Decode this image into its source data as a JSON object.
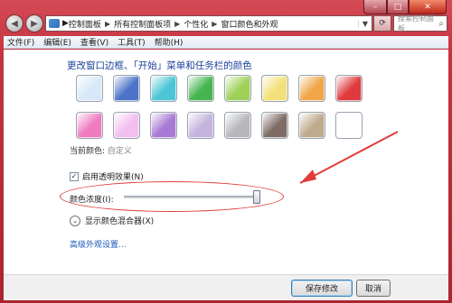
{
  "window": {
    "min_glyph": "–",
    "max_glyph": "□",
    "close_glyph": "✕"
  },
  "nav": {
    "back_glyph": "◀",
    "forward_glyph": "▶",
    "breadcrumb": [
      "控制面板",
      "所有控制面板项",
      "个性化",
      "窗口颜色和外观"
    ],
    "search_placeholder": "搜索控制面板"
  },
  "menu": [
    "文件(F)",
    "编辑(E)",
    "查看(V)",
    "工具(T)",
    "帮助(H)"
  ],
  "main": {
    "title": "更改窗口边框、「开始」菜单和任务栏的颜色",
    "swatches": [
      [
        "#d7e8f8",
        "#4c73c8",
        "#4cc6d6",
        "#45b54f",
        "#9fd05a",
        "#f3e07a",
        "#f1a64a",
        "#df3b3f"
      ],
      [
        "#ef7bbf",
        "#f3bff0",
        "#a97ad3",
        "#c4b3dc",
        "#b7b7bb",
        "#7d6b64",
        "#c0aa8d",
        "#ffffff"
      ]
    ],
    "current_color_label": "当前颜色:",
    "current_color_value": "自定义",
    "transparency_checked": true,
    "transparency_label": "启用透明效果(N)",
    "intensity_label": "颜色浓度(I):",
    "intensity_value": 0.95,
    "mixer_label": "显示颜色混合器(X)",
    "advanced_link": "高级外观设置..."
  },
  "footer": {
    "save_label": "保存修改",
    "cancel_label": "取消"
  },
  "colors": {
    "annotation_red": "#e03c3c",
    "title_blue": "#1a3f9c",
    "frame_red": "#c4343f"
  }
}
